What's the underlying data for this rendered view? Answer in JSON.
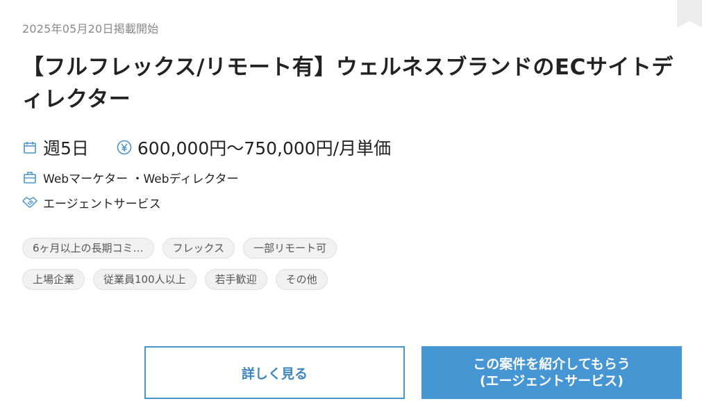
{
  "job": {
    "posted_date": "2025年05月20日掲載開始",
    "title": "【フルフレックス/リモート有】ウェルネスブランドのECサイトディレクター",
    "workdays": "週5日",
    "price": "600,000円〜750,000円/月単価",
    "job_type": "Webマーケター ・Webディレクター",
    "service": "エージェントサービス",
    "tags": [
      "6ヶ月以上の長期コミ…",
      "フレックス",
      "一部リモート可",
      "上場企業",
      "従業員100人以上",
      "若手歓迎",
      "その他"
    ]
  },
  "buttons": {
    "detail_label": "詳しく見る",
    "intro_label_line1": "この案件を紹介してもらう",
    "intro_label_line2": "(エージェントサービス)"
  },
  "icons": {
    "bookmark": "bookmark-icon",
    "calendar": "calendar-icon",
    "yen": "yen-icon",
    "briefcase": "briefcase-icon",
    "handshake": "handshake-icon"
  },
  "colors": {
    "accent": "#4596d3",
    "icon": "#4a94c9",
    "tag_bg": "#f1f1f1"
  }
}
